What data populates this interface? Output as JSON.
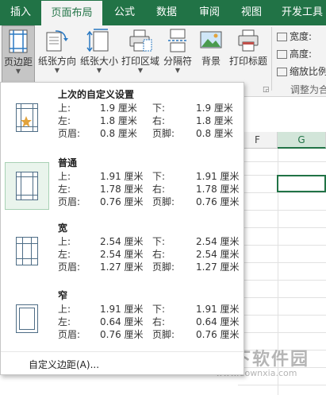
{
  "tabs": [
    {
      "label": "插入",
      "active": false
    },
    {
      "label": "页面布局",
      "active": true
    },
    {
      "label": "公式",
      "active": false
    },
    {
      "label": "数据",
      "active": false
    },
    {
      "label": "审阅",
      "active": false
    },
    {
      "label": "视图",
      "active": false
    },
    {
      "label": "开发工具",
      "active": false
    }
  ],
  "ribbon": {
    "buttons": [
      {
        "label": "页边距",
        "icon": "margins-icon"
      },
      {
        "label": "纸张方向",
        "icon": "orientation-icon"
      },
      {
        "label": "纸张大小",
        "icon": "paper-size-icon"
      },
      {
        "label": "打印区域",
        "icon": "print-area-icon"
      },
      {
        "label": "分隔符",
        "icon": "breaks-icon"
      },
      {
        "label": "背景",
        "icon": "background-icon"
      },
      {
        "label": "打印标题",
        "icon": "print-titles-icon"
      }
    ],
    "scale": {
      "width_label": "宽度:",
      "height_label": "高度:",
      "scale_label": "缩放比例"
    },
    "group_label": "调整为合"
  },
  "sheet": {
    "columns": [
      "F",
      "G"
    ],
    "selected_column": "G"
  },
  "margins_menu": {
    "field_labels": {
      "top": "上:",
      "bottom": "下:",
      "left": "左:",
      "right": "右:",
      "header": "页眉:",
      "footer": "页脚:"
    },
    "options": [
      {
        "name": "上次的自定义设置",
        "current": false,
        "top": "1.9 厘米",
        "bottom": "1.9 厘米",
        "left": "1.8 厘米",
        "right": "1.8 厘米",
        "header": "0.8 厘米",
        "footer": "0.8 厘米"
      },
      {
        "name": "普通",
        "current": true,
        "top": "1.91 厘米",
        "bottom": "1.91 厘米",
        "left": "1.78 厘米",
        "right": "1.78 厘米",
        "header": "0.76 厘米",
        "footer": "0.76 厘米"
      },
      {
        "name": "宽",
        "current": false,
        "top": "2.54 厘米",
        "bottom": "2.54 厘米",
        "left": "2.54 厘米",
        "right": "2.54 厘米",
        "header": "1.27 厘米",
        "footer": "1.27 厘米"
      },
      {
        "name": "窄",
        "current": false,
        "top": "1.91 厘米",
        "bottom": "1.91 厘米",
        "left": "0.64 厘米",
        "right": "0.64 厘米",
        "header": "0.76 厘米",
        "footer": "0.76 厘米"
      }
    ],
    "custom_label": "自定义边距(A)..."
  },
  "watermark": {
    "name": "当下软件园",
    "url": "www.downxia.com"
  },
  "colors": {
    "accent": "#217346",
    "margin_lines": "#4e6d86",
    "star": "#e2a33c"
  }
}
